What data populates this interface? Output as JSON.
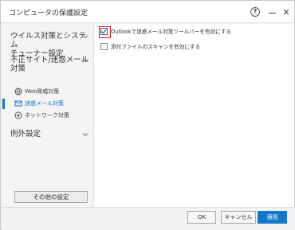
{
  "window": {
    "title": "コンピュータの保護設定",
    "help_label": "?",
    "close_label": "✕"
  },
  "sidebar": {
    "groups": [
      {
        "label_lines": [
          "ウイルス対策とシステム",
          "チューナー設定"
        ],
        "expanded": false
      },
      {
        "label_lines": [
          "不正サイト/迷惑メール",
          "対策"
        ],
        "expanded": true
      },
      {
        "label_lines": [
          "例外設定"
        ],
        "expanded": false
      }
    ],
    "items": [
      {
        "label": "Web脅威対策",
        "icon": "globe-shield-icon",
        "active": false
      },
      {
        "label": "迷惑メール対策",
        "icon": "mail-icon",
        "active": true
      },
      {
        "label": "ネットワーク対策",
        "icon": "network-icon",
        "active": false
      }
    ],
    "other_button": "その他の設定"
  },
  "content": {
    "options": [
      {
        "label": "Outlookで迷惑メール対策ツールバーを有効にする",
        "checked": true,
        "highlighted": true
      },
      {
        "label": "添付ファイルのスキャンを有効にする",
        "checked": false,
        "highlighted": false
      }
    ]
  },
  "footer": {
    "ok": "OK",
    "cancel": "キャンセル",
    "apply": "適用"
  },
  "colors": {
    "accent": "#1578c6",
    "highlight": "#d91c1c"
  }
}
